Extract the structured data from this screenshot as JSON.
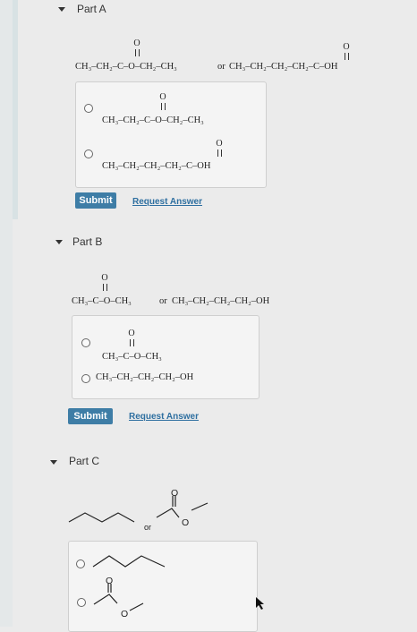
{
  "part_a": {
    "title": "Part A",
    "prompt_left": "CH₃–CH₂–C–O–CH₂–CH₃",
    "or_text": "or",
    "prompt_right": "CH₃–CH₂–CH₂–CH₂–C–OH",
    "option_1": "CH₃–CH₂–C–O–CH₂–CH₃",
    "option_2": "CH₃–CH₂–CH₂–CH₂–C–OH",
    "submit_label": "Submit",
    "request_label": "Request Answer"
  },
  "part_b": {
    "title": "Part B",
    "prompt_left": "CH₃–C–O–CH₃",
    "or_text": "or",
    "prompt_right": "CH₃–CH₂–CH₂–CH₂–OH",
    "option_1": "CH₃–C–O–CH₃",
    "option_2": "CH₃–CH₂–CH₂–CH₂–OH",
    "submit_label": "Submit",
    "request_label": "Request Answer"
  },
  "part_c": {
    "title": "Part C",
    "or_text": "or",
    "oxygen": "O"
  },
  "oxygen": "O",
  "colors": {
    "accent": "#3e7da6",
    "link": "#2e6fa0",
    "background": "#ebebeb"
  }
}
